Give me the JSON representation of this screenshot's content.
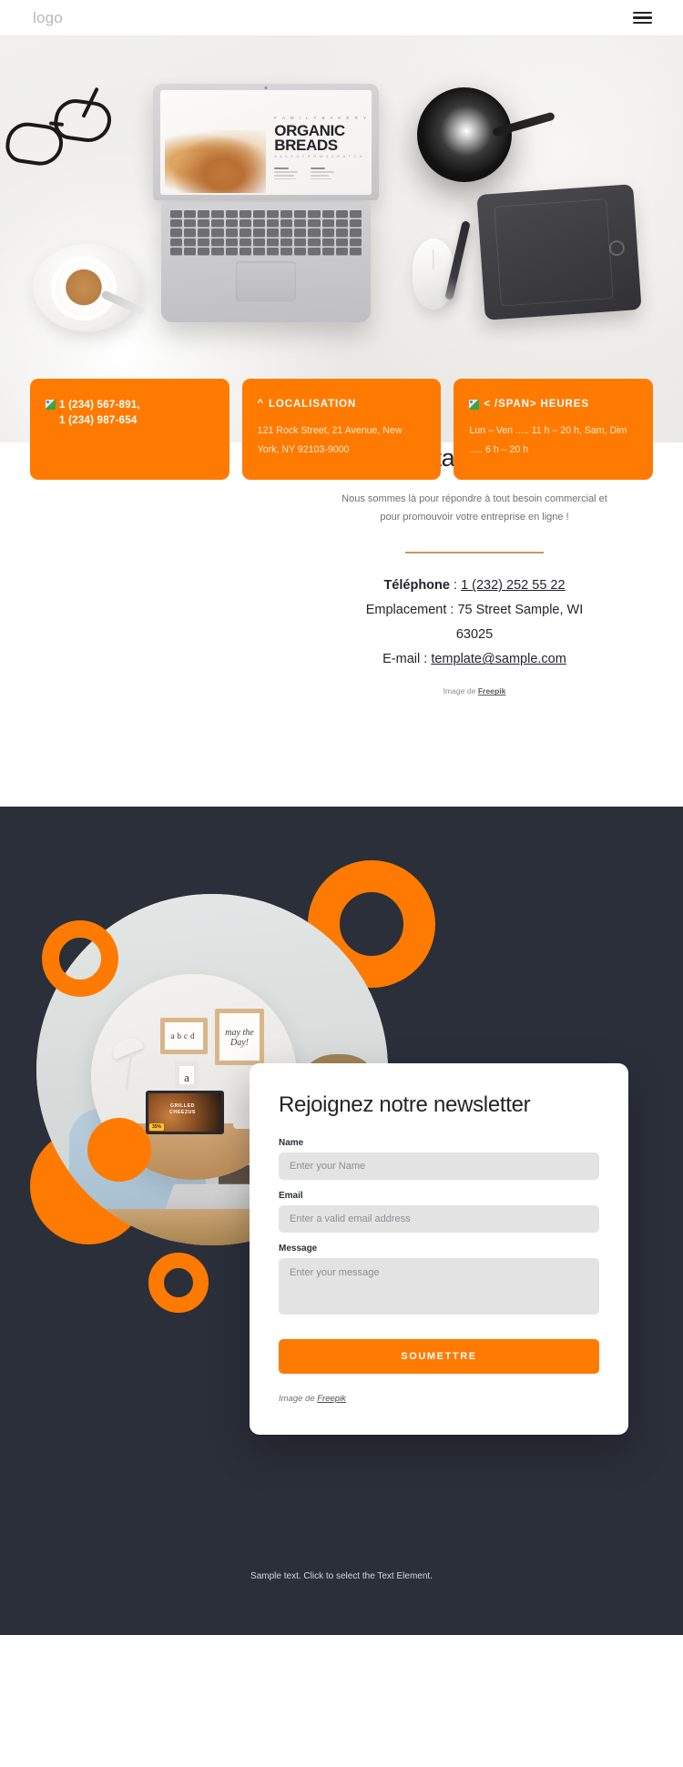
{
  "header": {
    "logo": "logo",
    "menu_icon": "hamburger-menu-icon"
  },
  "hero": {
    "laptop_screen": {
      "kicker": "F A M I L Y   B A K E R Y",
      "title_line1": "ORGANIC",
      "title_line2": "BREADS",
      "subtitle": "B A K E D   F R O M   S C R A T C H"
    }
  },
  "info_cards": [
    {
      "icon": "broken-image-icon",
      "heading": "",
      "phone_line1": "1 (234) 567-891,",
      "phone_line2": "1 (234) 987-654"
    },
    {
      "icon": "caret-up-icon",
      "heading": "LOCALISATION",
      "body_line1": "121 Rock Street, 21 Avenue, New",
      "body_line2": "York, NY 92103-9000"
    },
    {
      "icon": "broken-image-icon",
      "heading": "< /SPAN> HEURES",
      "body_line1": "Lun – Ven ..... 11 h – 20 h, Sam, Dim",
      "body_line2": "..... 6 h – 20 h"
    }
  ],
  "contact": {
    "title": "Contactez-nous",
    "description": "Nous sommes là pour répondre à tout besoin commercial et pour promouvoir votre entreprise en ligne !",
    "phone_label": "Téléphone",
    "phone_separator": " : ",
    "phone_value": "1 (232) 252 55 22",
    "location_line": "Emplacement : 75 Street Sample, WI",
    "location_zip": "63025",
    "email_label": "E-mail : ",
    "email_value": "template@sample.com",
    "credit_prefix": "Image de ",
    "credit_link": "Freepik"
  },
  "newsletter": {
    "title": "Rejoignez notre newsletter",
    "name_label": "Name",
    "name_placeholder": "Enter your Name",
    "name_value": "",
    "email_label": "Email",
    "email_placeholder": "Enter a valid email address",
    "email_value": "",
    "message_label": "Message",
    "message_placeholder": "Enter your message",
    "message_value": "",
    "submit_label": "SOUMETTRE",
    "credit_prefix": "Image de ",
    "credit_link": "Freepik"
  },
  "footer": {
    "text": "Sample text. Click to select the Text Element."
  },
  "colors": {
    "accent_orange": "#ff7a00",
    "dark_navy": "#2b2f3a",
    "divider_gold": "#c79a5b",
    "input_gray": "#e3e3e3"
  }
}
